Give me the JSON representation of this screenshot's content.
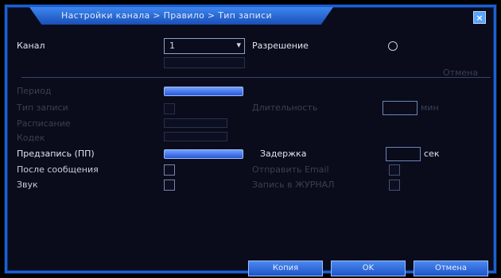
{
  "dialog": {
    "title": "Настройки канала > Правило > Тип записи",
    "close_label": "×"
  },
  "channel": {
    "label": "Канал",
    "value": "1",
    "arrow": "▾"
  },
  "enable": {
    "label": "Разрешение"
  },
  "right_hint": "Отмена",
  "rows": {
    "row1": "Период",
    "row2": "Тип записи",
    "row2_right": "Длительность",
    "row3": "Расписание",
    "row4": "Кодек",
    "row5": "Предзапись (ПП)",
    "row5_right": "Задержка",
    "row5_unit": "сек",
    "row2_unit": "мин",
    "row6": "После сообщения",
    "row6_right": "Отправить Email",
    "row7": "Звук",
    "row7_right": "Запись в ЖУРНАЛ"
  },
  "buttons": {
    "copy": "Копия",
    "ok": "OK",
    "cancel": "Отмена"
  }
}
